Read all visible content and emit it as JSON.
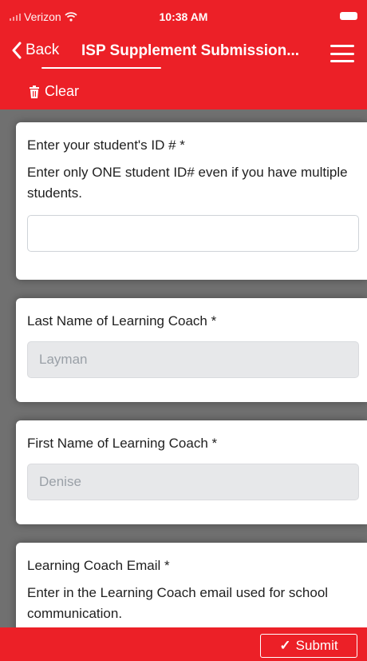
{
  "status_bar": {
    "carrier": "Verizon",
    "time": "10:38 AM"
  },
  "navbar": {
    "back_label": "Back",
    "title": "ISP Supplement Submission...",
    "menu_icon": "hamburger-menu-icon"
  },
  "toolbar": {
    "clear_label": "Clear",
    "clear_icon": "trash-icon"
  },
  "form": {
    "student_id": {
      "label": "Enter your student's ID #  *",
      "help": "Enter only ONE student ID# even if you have multiple students.",
      "value": ""
    },
    "last_name": {
      "label": "Last Name of Learning Coach *",
      "value": "Layman"
    },
    "first_name": {
      "label": "First Name of Learning Coach *",
      "value": "Denise"
    },
    "email": {
      "label": "Learning Coach Email  *",
      "help": "Enter in the Learning Coach email used for school communication."
    }
  },
  "footer": {
    "submit_label": "Submit",
    "submit_icon": "checkmark-icon"
  },
  "colors": {
    "brand_red": "#ec2027",
    "backdrop_gray": "#707070"
  }
}
